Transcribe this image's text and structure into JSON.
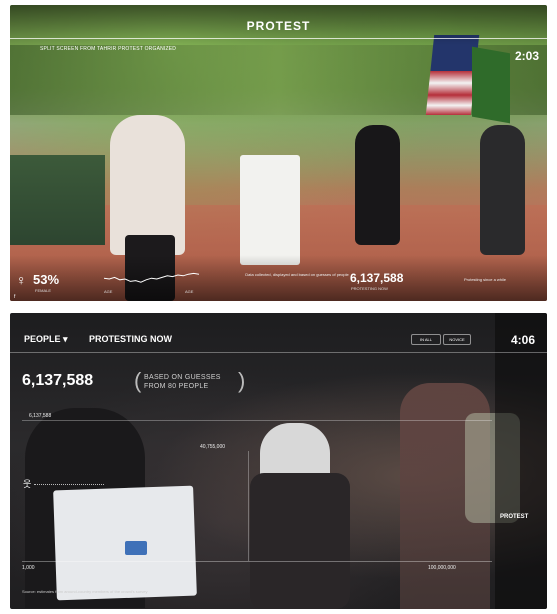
{
  "panel1": {
    "title": "PROTEST",
    "subtitle": "SPLIT SCREEN FROM TAHRIR PROTEST ORGANIZED",
    "time": "2:03",
    "female_icon": "♀",
    "female_pct": "53%",
    "female_caption": "FEMALE",
    "line_label_a": "AGE",
    "line_label_b": "AGE",
    "middle_note": "Data collected, displayed and based on guesses of people",
    "count": "6,137,588",
    "count_caption": "PROTESTING NOW",
    "right_note": "Protesting since a while",
    "corner": "f",
    "sparkline": [
      0.55,
      0.5,
      0.6,
      0.45,
      0.5,
      0.35,
      0.4,
      0.3,
      0.45,
      0.55,
      0.5,
      0.6,
      0.7,
      0.65,
      0.75,
      0.7,
      0.8,
      0.85,
      0.8
    ]
  },
  "panel2": {
    "section": "PEOPLE ▾",
    "heading": "PROTESTING NOW",
    "pill_1": "IN ALL",
    "pill_2": "NOVICE",
    "time": "4:06",
    "count": "6,137,588",
    "based_on": "BASED ON GUESSES FROM 80 PEOPLE",
    "bracket_open": "(",
    "bracket_close": ")",
    "top_tick": "6,137,588",
    "mid_tick": "40,755,000",
    "axis_min": "1,000",
    "axis_max": "100,000,000",
    "protest_label": "PROTEST",
    "person_icon": "웃",
    "footer": "Source: estimates from around-country members of the crowd's survey"
  },
  "colors": {
    "text": "#ffffff",
    "panel2_bg": "#1f1e20"
  },
  "icons": {
    "female": "female-icon",
    "person": "person-icon"
  }
}
